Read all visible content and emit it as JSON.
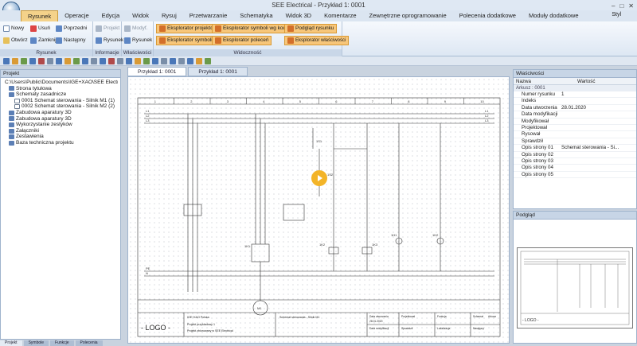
{
  "window": {
    "title": "SEE Electrical - Przykład 1: 0001"
  },
  "menu": {
    "tabs": [
      "Rysunek",
      "Operacje",
      "Edycja",
      "Widok",
      "Rysuj",
      "Przetwarzanie",
      "Schematyka",
      "Widok 3D",
      "Komentarze",
      "Zewnętrzne oprogramowanie",
      "Polecenia dodatkowe",
      "Moduły dodatkowe"
    ],
    "style_label": "Styl"
  },
  "ribbon": {
    "rysunek": {
      "new": "Nowy",
      "delete": "Usuń",
      "previous": "Poprzedni",
      "open": "Otwórz",
      "close": "Zamknij",
      "next": "Następny",
      "label": "Rysunek"
    },
    "informacje": {
      "project": "Projekt",
      "drawing": "Rysunek",
      "label": "Informacje"
    },
    "wlasciwosci": {
      "modify": "Modyf.",
      "drawing": "Rysunek",
      "label": "Właściwości"
    },
    "widocznosc": {
      "label": "Widoczność",
      "project_explorer": "Eksplorator projektów",
      "symbol_explorer_code": "Eksplorator symboli wg kodu",
      "drawing_preview": "Podgląd rysunku",
      "symbol_explorer": "Eksplorator symboli",
      "command_explorer": "Eksplorator poleceń",
      "property_explorer": "Eksplorator właściwości"
    }
  },
  "project_panel": {
    "title": "Projekt",
    "tree": [
      {
        "label": "C:\\Users\\Public\\Documents\\IGE+XAO\\SEE Electrical\\",
        "level": 0
      },
      {
        "label": "Strona tytułowa",
        "level": 1
      },
      {
        "label": "Schematy zasadnicze",
        "level": 1
      },
      {
        "label": "0001 Schemat sterowania - Silnik M1 (1)",
        "level": 2
      },
      {
        "label": "0002 Schemat sterowania - Silnik M2 (2)",
        "level": 2
      },
      {
        "label": "Zabudowa aparatury 3D",
        "level": 1
      },
      {
        "label": "Zabudowa aparatury 3D",
        "level": 1
      },
      {
        "label": "Wykorzystanie zestyków",
        "level": 1
      },
      {
        "label": "Załączniki",
        "level": 1
      },
      {
        "label": "Zestawienia",
        "level": 1
      },
      {
        "label": "Baza techniczna projektu",
        "level": 1
      }
    ]
  },
  "document_tabs": [
    "Przykład 1: 0001",
    "Przykład 1: 0001"
  ],
  "properties_panel": {
    "title": "Właściwości",
    "col_name": "Nazwa",
    "col_value": "Wartość",
    "group": "Arkusz : 0001",
    "rows": [
      {
        "k": "Numer rysunku",
        "v": "1"
      },
      {
        "k": "Indeks",
        "v": ""
      },
      {
        "k": "Data utworzenia",
        "v": "28.01.2020"
      },
      {
        "k": "Data modyfikacji",
        "v": ""
      },
      {
        "k": "Modyfikował",
        "v": ""
      },
      {
        "k": "Projektował",
        "v": ""
      },
      {
        "k": "Rysował",
        "v": ""
      },
      {
        "k": "Sprawdził",
        "v": ""
      },
      {
        "k": "Opis strony 01",
        "v": "Schemat sterowania - Si..."
      },
      {
        "k": "Opis strony 02",
        "v": ""
      },
      {
        "k": "Opis strony 03",
        "v": ""
      },
      {
        "k": "Opis strony 04",
        "v": ""
      },
      {
        "k": "Opis strony 05",
        "v": ""
      }
    ]
  },
  "preview_panel": {
    "title": "Podgląd"
  },
  "drawing": {
    "logo": "- LOGO -",
    "company": "IGE+XAO Polska",
    "project_line1": "Projekt przykładowy 1",
    "project_line2": "Projekt zbiorowany w SEE Electrical",
    "sheet_title": "Schemat sterowania - Silnik M1",
    "created_label": "Data utworzenia",
    "created_value": "28.01.2020",
    "modified_label": "Data modyfikacji",
    "designed_label": "Projektował",
    "checked_label": "Sprawdził",
    "function_label": "Funkcja",
    "location_label": "Lokalizacja",
    "scheme_label": "Schemat",
    "next_label": "Następny",
    "sheet_label": "Arkusz",
    "column_numbers": [
      "1",
      "2",
      "3",
      "4",
      "5",
      "6",
      "7",
      "8",
      "9",
      "10"
    ],
    "bus_left": [
      "L1",
      "L2",
      "L3",
      "PE",
      "N"
    ],
    "bus_right": [
      "L1",
      "L2",
      "L3"
    ],
    "motor_label": "M1",
    "contactor_labels": [
      "1K1",
      "1K2",
      "1K3",
      "1S1",
      "1S2",
      "1H1",
      "1H2"
    ]
  },
  "bottom_tabs": [
    "Projekt",
    "Symbole",
    "Funkcje",
    "Polecenia"
  ]
}
